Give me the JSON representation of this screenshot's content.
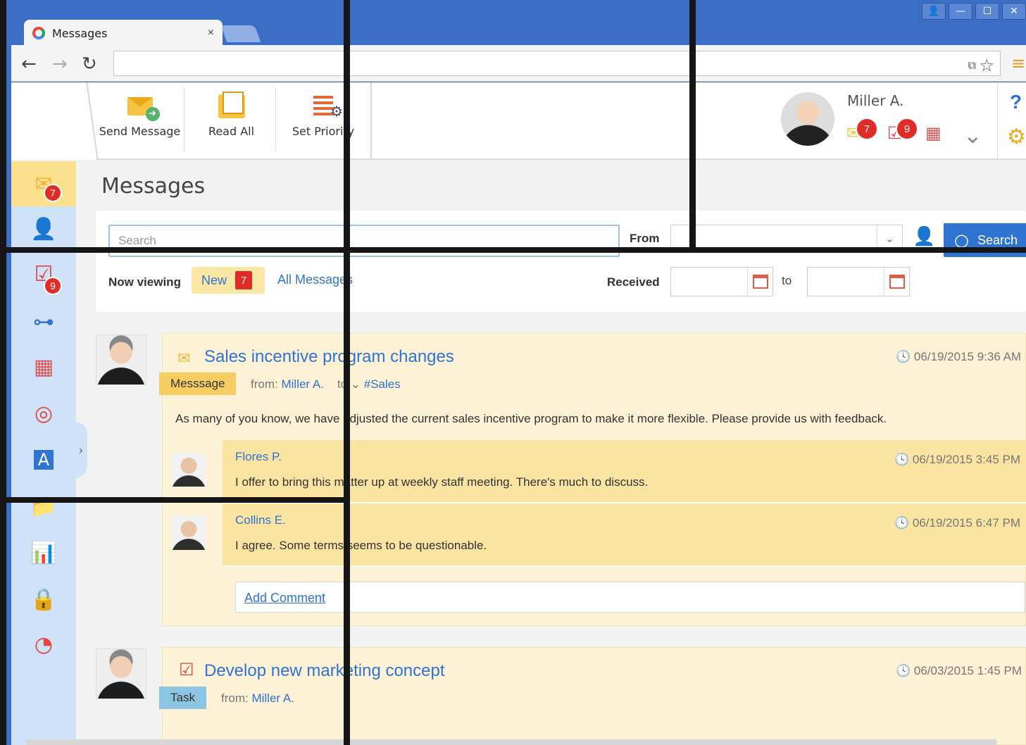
{
  "browser": {
    "tab_title": "Messages",
    "tab_close": "×",
    "nav": {
      "back": "←",
      "forward": "→",
      "reload": "↻"
    },
    "win_controls": [
      "👤",
      "—",
      "☐",
      "✕"
    ]
  },
  "toolbar": {
    "actions": [
      {
        "label": "Send Message",
        "icon": "send-message-icon"
      },
      {
        "label": "Read All",
        "icon": "read-all-icon"
      },
      {
        "label": "Set Priority",
        "icon": "set-priority-icon"
      }
    ]
  },
  "user": {
    "name": "Miller A.",
    "messages_badge": "7",
    "tasks_badge": "9",
    "help": "?"
  },
  "leftnav": {
    "items": [
      {
        "icon": "messages-icon",
        "glyph": "✉",
        "badge": "7"
      },
      {
        "icon": "contacts-icon",
        "glyph": "👤"
      },
      {
        "icon": "tasks-icon",
        "glyph": "☑",
        "badge": "9"
      },
      {
        "icon": "org-structure-icon",
        "glyph": "⊶"
      },
      {
        "icon": "calendar-icon",
        "glyph": "▦"
      },
      {
        "icon": "processes-icon",
        "glyph": "◎"
      },
      {
        "icon": "contracts-icon",
        "glyph": "A"
      },
      {
        "icon": "documents-icon",
        "glyph": "📁"
      },
      {
        "icon": "reports-icon",
        "glyph": "📊"
      },
      {
        "icon": "security-icon",
        "glyph": "🔒"
      },
      {
        "icon": "dashboard-icon",
        "glyph": "◔"
      }
    ],
    "collapse": "›"
  },
  "page": {
    "title": "Messages"
  },
  "filter": {
    "search_placeholder": "Search",
    "from_label": "From",
    "search_button": "Search",
    "now_viewing_label": "Now viewing",
    "new_label": "New",
    "new_count": "7",
    "all_messages": "All Messages",
    "received_label": "Received",
    "to_label": "to"
  },
  "feed": [
    {
      "title": "Sales incentive program changes",
      "time": "06/19/2015 9:36 AM",
      "tag": "Messsage",
      "from_prefix": "from:",
      "from": "Miller A.",
      "to_prefix": "to",
      "to": "#Sales",
      "body": "As many of you know, we have adjusted the current sales incentive program to make it more flexible. Please provide us with feedback.",
      "comments": [
        {
          "author": "Flores P.",
          "time": "06/19/2015 3:45 PM",
          "text": "I offer to bring this matter up at weekly staff meeting. There's much to discuss."
        },
        {
          "author": "Collins E.",
          "time": "06/19/2015 6:47 PM",
          "text": "I agree. Some terms seems to be questionable."
        }
      ],
      "add_comment": "Add Comment"
    },
    {
      "title": "Develop new marketing concept",
      "time": "06/03/2015 1:45 PM",
      "tag": "Task",
      "from_prefix": "from:",
      "from": "Miller A."
    }
  ]
}
